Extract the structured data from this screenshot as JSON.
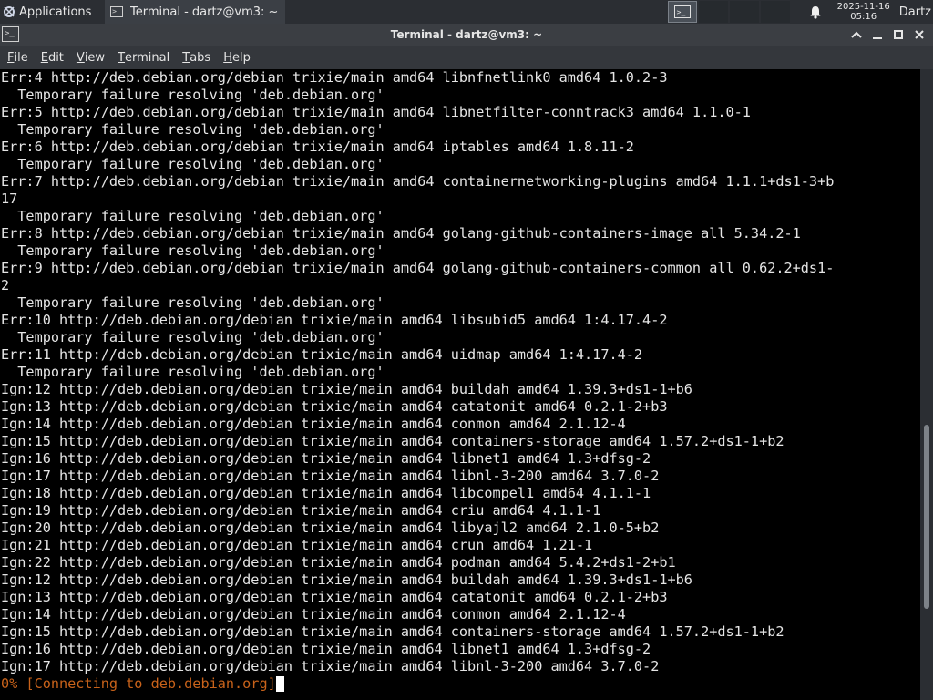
{
  "panel": {
    "applications_label": "Applications",
    "task_title": "Terminal - dartz@vm3: ~",
    "clock_date": "2025-11-16",
    "clock_time": "05:16",
    "user": "Dartz",
    "workspace_count": 4,
    "active_workspace": 1
  },
  "window": {
    "title": "Terminal - dartz@vm3: ~",
    "controls": [
      "chevron-up-icon",
      "minimize-icon",
      "maximize-icon",
      "close-icon"
    ]
  },
  "menu": [
    {
      "label": "File",
      "mnemonic": "F",
      "rest": "ile"
    },
    {
      "label": "Edit",
      "mnemonic": "E",
      "rest": "dit"
    },
    {
      "label": "View",
      "mnemonic": "V",
      "rest": "iew"
    },
    {
      "label": "Terminal",
      "mnemonic": "T",
      "rest": "erminal"
    },
    {
      "label": "Tabs",
      "mnemonic": "T",
      "rest": "abs"
    },
    {
      "label": "Help",
      "mnemonic": "H",
      "rest": "elp"
    }
  ],
  "terminal": {
    "lines": [
      "Err:4 http://deb.debian.org/debian trixie/main amd64 libnfnetlink0 amd64 1.0.2-3",
      "  Temporary failure resolving 'deb.debian.org'",
      "Err:5 http://deb.debian.org/debian trixie/main amd64 libnetfilter-conntrack3 amd64 1.1.0-1",
      "  Temporary failure resolving 'deb.debian.org'",
      "Err:6 http://deb.debian.org/debian trixie/main amd64 iptables amd64 1.8.11-2",
      "  Temporary failure resolving 'deb.debian.org'",
      "Err:7 http://deb.debian.org/debian trixie/main amd64 containernetworking-plugins amd64 1.1.1+ds1-3+b",
      "17",
      "  Temporary failure resolving 'deb.debian.org'",
      "Err:8 http://deb.debian.org/debian trixie/main amd64 golang-github-containers-image all 5.34.2-1",
      "  Temporary failure resolving 'deb.debian.org'",
      "Err:9 http://deb.debian.org/debian trixie/main amd64 golang-github-containers-common all 0.62.2+ds1-",
      "2",
      "  Temporary failure resolving 'deb.debian.org'",
      "Err:10 http://deb.debian.org/debian trixie/main amd64 libsubid5 amd64 1:4.17.4-2",
      "  Temporary failure resolving 'deb.debian.org'",
      "Err:11 http://deb.debian.org/debian trixie/main amd64 uidmap amd64 1:4.17.4-2",
      "  Temporary failure resolving 'deb.debian.org'",
      "Ign:12 http://deb.debian.org/debian trixie/main amd64 buildah amd64 1.39.3+ds1-1+b6",
      "Ign:13 http://deb.debian.org/debian trixie/main amd64 catatonit amd64 0.2.1-2+b3",
      "Ign:14 http://deb.debian.org/debian trixie/main amd64 conmon amd64 2.1.12-4",
      "Ign:15 http://deb.debian.org/debian trixie/main amd64 containers-storage amd64 1.57.2+ds1-1+b2",
      "Ign:16 http://deb.debian.org/debian trixie/main amd64 libnet1 amd64 1.3+dfsg-2",
      "Ign:17 http://deb.debian.org/debian trixie/main amd64 libnl-3-200 amd64 3.7.0-2",
      "Ign:18 http://deb.debian.org/debian trixie/main amd64 libcompel1 amd64 4.1.1-1",
      "Ign:19 http://deb.debian.org/debian trixie/main amd64 criu amd64 4.1.1-1",
      "Ign:20 http://deb.debian.org/debian trixie/main amd64 libyajl2 amd64 2.1.0-5+b2",
      "Ign:21 http://deb.debian.org/debian trixie/main amd64 crun amd64 1.21-1",
      "Ign:22 http://deb.debian.org/debian trixie/main amd64 podman amd64 5.4.2+ds1-2+b1",
      "Ign:12 http://deb.debian.org/debian trixie/main amd64 buildah amd64 1.39.3+ds1-1+b6",
      "Ign:13 http://deb.debian.org/debian trixie/main amd64 catatonit amd64 0.2.1-2+b3",
      "Ign:14 http://deb.debian.org/debian trixie/main amd64 conmon amd64 2.1.12-4",
      "Ign:15 http://deb.debian.org/debian trixie/main amd64 containers-storage amd64 1.57.2+ds1-1+b2",
      "Ign:16 http://deb.debian.org/debian trixie/main amd64 libnet1 amd64 1.3+dfsg-2",
      "Ign:17 http://deb.debian.org/debian trixie/main amd64 libnl-3-200 amd64 3.7.0-2"
    ],
    "progress_line": "0% [Connecting to deb.debian.org]",
    "progress_color": "#c8621a",
    "scroll_position": 0.8,
    "scroll_visible_fraction": 0.3
  }
}
